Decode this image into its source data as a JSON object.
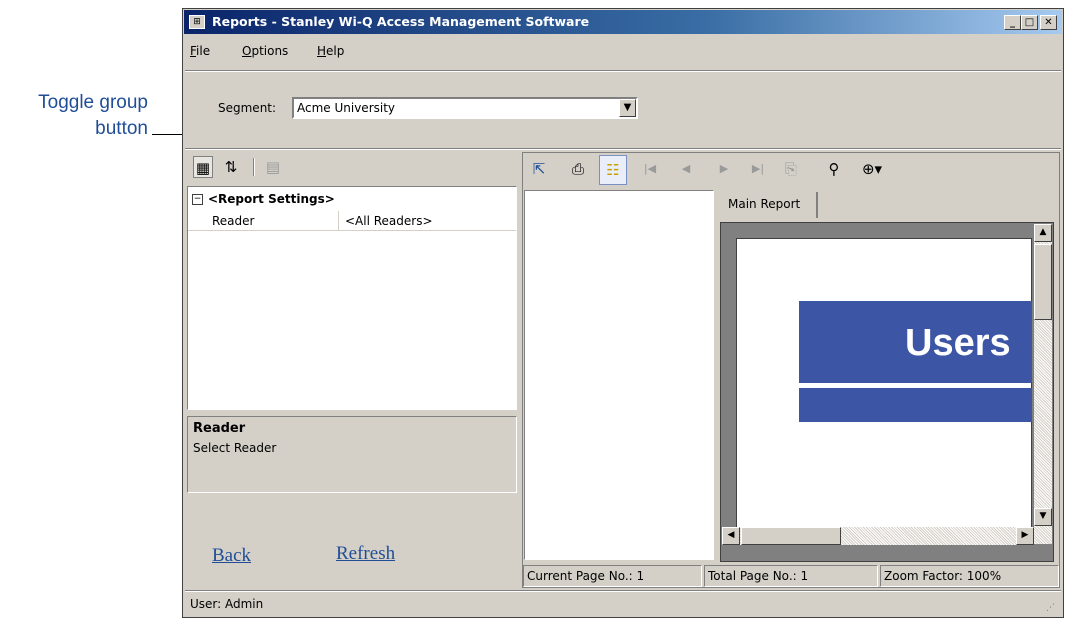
{
  "callout": {
    "line1": "Toggle group",
    "line2": "button"
  },
  "window": {
    "title": "Reports - Stanley Wi-Q Access Management Software",
    "menu": [
      {
        "label_u": "F",
        "label_rest": "ile"
      },
      {
        "label_u": "O",
        "label_rest": "ptions"
      },
      {
        "label_u": "H",
        "label_rest": "elp"
      }
    ],
    "segment": {
      "label": "Segment:",
      "value": "Acme University"
    },
    "caption_buttons": {
      "minimize": "_",
      "maximize": "□",
      "close": "✕"
    }
  },
  "property_grid": {
    "category": "<Report Settings>",
    "rows": [
      {
        "name": "Reader",
        "value": "<All Readers>"
      }
    ],
    "help_title": "Reader",
    "help_text": "Select Reader"
  },
  "links": {
    "back": "Back",
    "refresh": "Refresh"
  },
  "report_viewer": {
    "tab_label": "Main Report",
    "banner_text": "Users",
    "status": {
      "current_page": "Current Page No.: 1",
      "total_page": "Total Page No.: 1",
      "zoom": "Zoom Factor: 100%"
    }
  },
  "statusbar": {
    "user": "User: Admin"
  }
}
